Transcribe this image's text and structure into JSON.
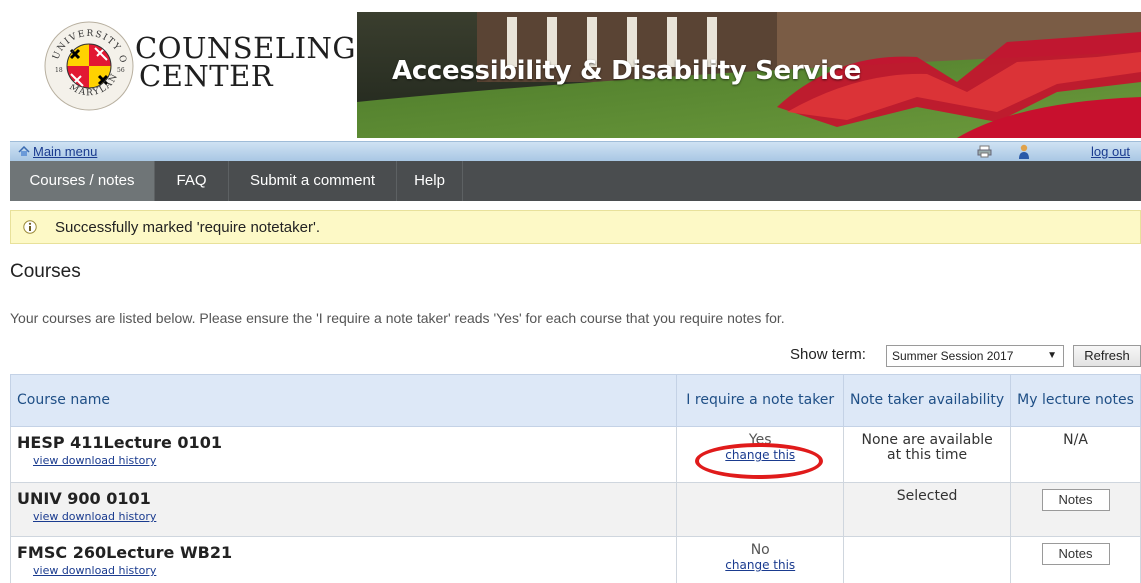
{
  "header": {
    "logo_line1": "COUNSELING",
    "logo_line2": "CENTER",
    "seal_text_top": "UNIVERSITY OF",
    "seal_text_bottom": "MARYLAND",
    "seal_year_left": "18",
    "seal_year_right": "56",
    "service_title": "Accessibility & Disability Service"
  },
  "utility": {
    "main_menu": "Main menu",
    "logout": "log out"
  },
  "nav": {
    "tabs": [
      {
        "label": "Courses / notes"
      },
      {
        "label": "FAQ"
      },
      {
        "label": "Submit a comment"
      },
      {
        "label": "Help"
      }
    ]
  },
  "notice": {
    "message": "Successfully marked 'require notetaker'."
  },
  "page": {
    "title": "Courses",
    "intro": "Your courses are listed below. Please ensure the 'I require a note taker' reads 'Yes' for each course that you require notes for."
  },
  "term": {
    "label": "Show term:",
    "selected": "Summer Session 2017",
    "refresh": "Refresh"
  },
  "table": {
    "headers": [
      "Course name",
      "I require a note taker",
      "Note taker availability",
      "My lecture notes"
    ],
    "rows": [
      {
        "course": "HESP 411Lecture 0101",
        "link": "view download history",
        "require": "Yes",
        "change": "change this",
        "availability": "None are available at this time",
        "notes": "N/A"
      },
      {
        "course": "UNIV 900 0101",
        "link": "view download history",
        "require": "",
        "change": "",
        "availability": "Selected",
        "notes": "Notes"
      },
      {
        "course": "FMSC 260Lecture WB21",
        "link": "view download history",
        "require": "No",
        "change": "change this",
        "availability": "",
        "notes": "Notes"
      }
    ]
  },
  "colors": {
    "nav_bg": "#4a4d4f",
    "notice_bg": "#fdf9c6",
    "header_bg": "#dde8f7",
    "highlight": "#e01b1b"
  }
}
